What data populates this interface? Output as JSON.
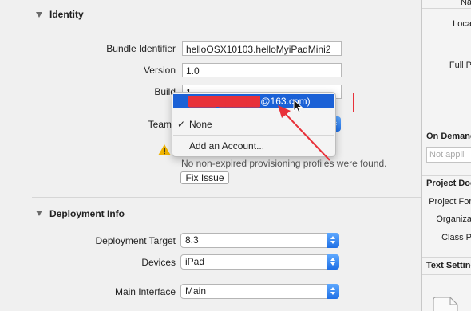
{
  "identity": {
    "title": "Identity",
    "bundle_identifier_label": "Bundle Identifier",
    "bundle_identifier_value": "helloOSX10103.helloMyiPadMini2",
    "version_label": "Version",
    "version_value": "1.0",
    "build_label": "Build",
    "build_value": "1",
    "team_label": "Team",
    "warning_text": "No non-expired provisioning profiles were found.",
    "fix_issue_label": "Fix Issue"
  },
  "team_menu": {
    "account_item": "@163.com)",
    "account_redacted": "████ ██████",
    "none_item": "None",
    "none_checkmark": "✓",
    "add_account_item": "Add an Account..."
  },
  "deployment": {
    "title": "Deployment Info",
    "target_label": "Deployment Target",
    "target_value": "8.3",
    "devices_label": "Devices",
    "devices_value": "iPad",
    "main_interface_label": "Main Interface",
    "main_interface_value": "Main"
  },
  "inspector": {
    "name_label": "Na",
    "location_label": "Loca",
    "full_path_label": "Full P",
    "on_demand_title": "On Demand",
    "on_demand_placeholder": "Not appli",
    "project_doc_title": "Project Doc",
    "project_format_label": "Project For",
    "organization_label": "Organiza",
    "class_prefix_label": "Class P",
    "text_settings_title": "Text Setting"
  },
  "colors": {
    "highlight": "#1b61d6",
    "annotation_red": "#e8313a",
    "warning": "#f0b400"
  }
}
